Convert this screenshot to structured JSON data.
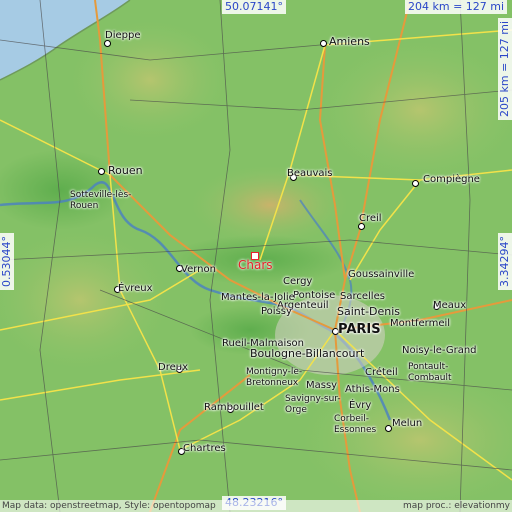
{
  "coords": {
    "top": "50.07141°",
    "bottom": "48.23216°",
    "left": "0.53044°",
    "right": "3.34294°",
    "scale_horizontal": "204 km = 127 mi",
    "scale_vertical": "205 km = 127 mi"
  },
  "highlight": {
    "name": "Chars"
  },
  "cities": [
    {
      "name": "Amiens"
    },
    {
      "name": "Dieppe"
    },
    {
      "name": "Rouen"
    },
    {
      "name": "Sotteville-lès-\nRouen"
    },
    {
      "name": "Beauvais"
    },
    {
      "name": "Compiègne"
    },
    {
      "name": "Creil"
    },
    {
      "name": "Vernon"
    },
    {
      "name": "Évreux"
    },
    {
      "name": "Cergy"
    },
    {
      "name": "Goussainville"
    },
    {
      "name": "Pontoise"
    },
    {
      "name": "Sarcelles"
    },
    {
      "name": "Argenteuil"
    },
    {
      "name": "Mantes-la-Jolie"
    },
    {
      "name": "Poissy"
    },
    {
      "name": "Saint-Denis"
    },
    {
      "name": "Meaux"
    },
    {
      "name": "Montfermeil"
    },
    {
      "name": "PARIS"
    },
    {
      "name": "Rueil-Malmaison"
    },
    {
      "name": "Boulogne-Billancourt"
    },
    {
      "name": "Noisy-le-Grand"
    },
    {
      "name": "Dreux"
    },
    {
      "name": "Créteil"
    },
    {
      "name": "Pontault-\nCombault"
    },
    {
      "name": "Montigny-le-\nBretonneux"
    },
    {
      "name": "Massy"
    },
    {
      "name": "Athis-Mons"
    },
    {
      "name": "Savigny-sur-\nOrge"
    },
    {
      "name": "Évry"
    },
    {
      "name": "Rambouillet"
    },
    {
      "name": "Corbeil-\nEssonnes"
    },
    {
      "name": "Melun"
    },
    {
      "name": "Chartres"
    }
  ],
  "footer": {
    "left": "Map data: openstreetmap, Style: opentopomap",
    "right": "map proc.: elevationmy"
  }
}
